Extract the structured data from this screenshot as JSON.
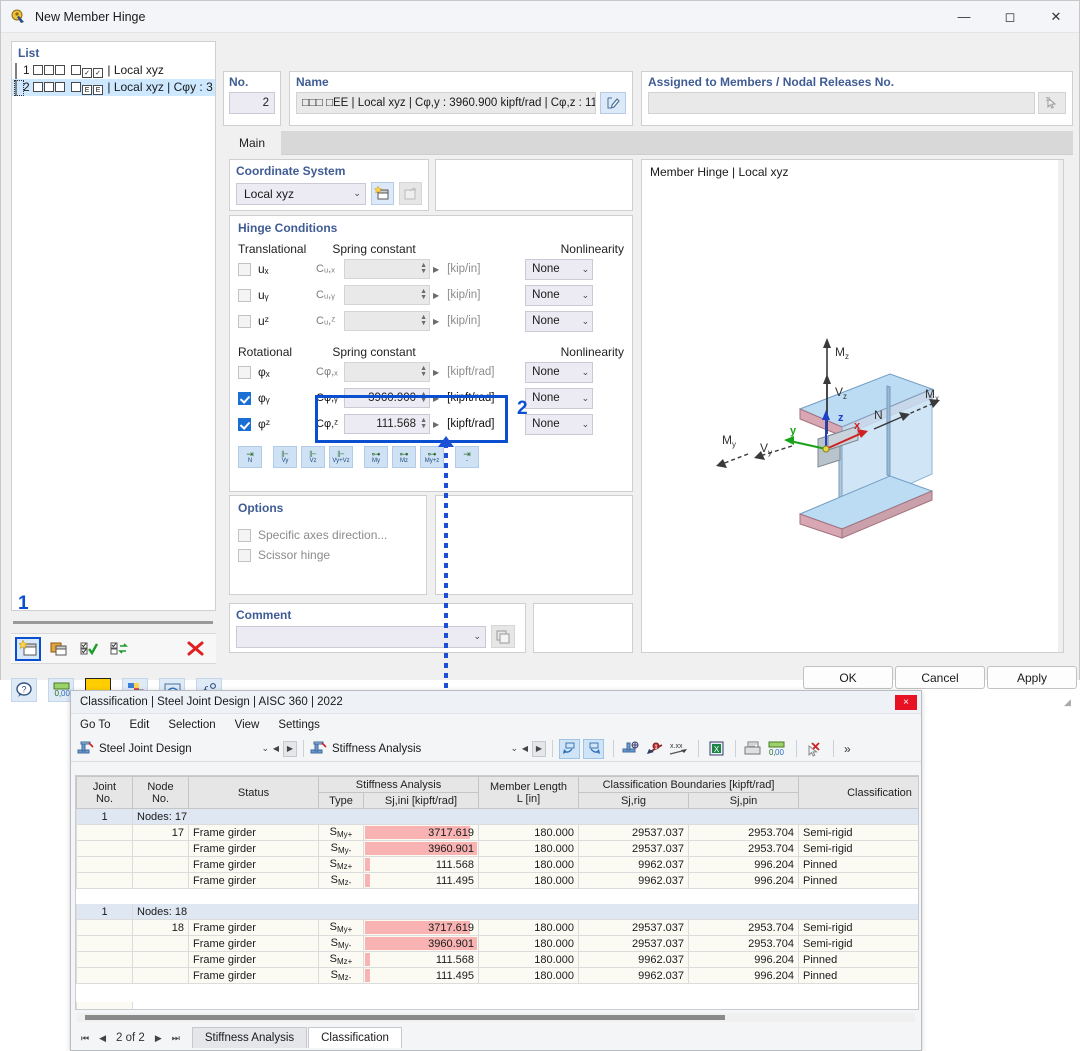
{
  "dialog": {
    "title": "New Member Hinge",
    "window_buttons": {
      "minimize": "—",
      "maximize": "◻",
      "close": "✕"
    },
    "list": {
      "label": "List",
      "items": [
        {
          "num": "1",
          "glyphs": [
            "",
            "",
            "",
            "",
            "✓",
            "✓"
          ],
          "text": "| Local xyz",
          "color": "#bff0ef",
          "selected": false
        },
        {
          "num": "2",
          "glyphs": [
            "",
            "",
            "",
            "",
            "E",
            "E"
          ],
          "text": "| Local xyz | Cφy : 3",
          "color": "#a0a32a",
          "selected": true
        }
      ],
      "marker": "1"
    },
    "no": {
      "label": "No.",
      "value": "2"
    },
    "name": {
      "label": "Name",
      "value": "□□□  □EE | Local xyz | Cφ,y : 3960.900 kipft/rad | Cφ,z : 11"
    },
    "assigned": {
      "label": "Assigned to Members / Nodal Releases No.",
      "value": ""
    },
    "tabs": [
      {
        "label": "Main",
        "active": true
      }
    ],
    "coordinate_system": {
      "label": "Coordinate System",
      "value": "Local xyz"
    },
    "hinge_conditions": {
      "label": "Hinge Conditions",
      "translational_header": "Translational",
      "rotational_header": "Rotational",
      "spring_header": "Spring constant",
      "nonlinearity_header": "Nonlinearity",
      "translational_rows": [
        {
          "dof": "uₓ",
          "const": "Cᵤ,ₓ",
          "value": "",
          "unit": "[kip/in]",
          "nonlinearity": "None",
          "checked": false
        },
        {
          "dof": "uᵧ",
          "const": "Cᵤ,ᵧ",
          "value": "",
          "unit": "[kip/in]",
          "nonlinearity": "None",
          "checked": false
        },
        {
          "dof": "uᶻ",
          "const": "Cᵤ,ᶻ",
          "value": "",
          "unit": "[kip/in]",
          "nonlinearity": "None",
          "checked": false
        }
      ],
      "rotational_rows": [
        {
          "dof": "φₓ",
          "const": "Cφ,ₓ",
          "value": "",
          "unit": "[kipft/rad]",
          "nonlinearity": "None",
          "checked": false
        },
        {
          "dof": "φᵧ",
          "const": "Cφ,ᵧ",
          "value": "3960.900",
          "unit": "[kipft/rad]",
          "nonlinearity": "None",
          "checked": true
        },
        {
          "dof": "φᶻ",
          "const": "Cφ,ᶻ",
          "value": "111.568",
          "unit": "[kipft/rad]",
          "nonlinearity": "None",
          "checked": true
        }
      ],
      "marker": "2",
      "preset_buttons": [
        "N",
        "Vy",
        "Vz",
        "Vy+Vz",
        "My",
        "Mz",
        "My+z",
        "-"
      ]
    },
    "options": {
      "label": "Options",
      "items": [
        {
          "label": "Specific axes direction...",
          "checked": false
        },
        {
          "label": "Scissor hinge",
          "checked": false
        }
      ]
    },
    "comment": {
      "label": "Comment",
      "value": ""
    },
    "preview": {
      "title": "Member Hinge | Local xyz",
      "labels": {
        "mz": "M",
        "mz_sub": "z",
        "vz": "V",
        "vz_sub": "z",
        "mx": "M",
        "mx_sub": "x",
        "n": "N",
        "my": "M",
        "my_sub": "y",
        "vy": "V",
        "vy_sub": "y",
        "axis_x": "x",
        "axis_y": "y",
        "axis_z": "z"
      }
    },
    "footer": {
      "ok": "OK",
      "cancel": "Cancel",
      "apply": "Apply"
    }
  },
  "classification": {
    "title": "Classification | Steel Joint Design | AISC 360 | 2022",
    "close": "×",
    "menu": [
      "Go To",
      "Edit",
      "Selection",
      "View",
      "Settings"
    ],
    "toolbar": {
      "left_combo": "Steel Joint Design",
      "right_combo": "Stiffness Analysis",
      "overflow": "»"
    },
    "table": {
      "headers": {
        "joint_no": "Joint",
        "joint_no2": "No.",
        "node_no": "Node",
        "node_no2": "No.",
        "status": "Status",
        "stiffness_analysis": "Stiffness Analysis",
        "type": "Type",
        "sj_ini": "Sj,ini [kipft/rad]",
        "member_length": "Member Length",
        "member_length2": "L [in]",
        "classification_boundaries": "Classification Boundaries [kipft/rad]",
        "sj_rig": "Sj,rig",
        "sj_pin": "Sj,pin",
        "classification": "Classification"
      },
      "groups": [
        {
          "joint_no": "1",
          "group_label": "Nodes: 17",
          "rows": [
            {
              "node_no": "17",
              "status": "Frame girder",
              "type": "S",
              "type_sub": "My+",
              "sj_ini": "3717.619",
              "bar": 0.92,
              "length": "180.000",
              "sj_rig": "29537.037",
              "sj_pin": "2953.704",
              "classification": "Semi-rigid"
            },
            {
              "node_no": "",
              "status": "Frame girder",
              "type": "S",
              "type_sub": "My-",
              "sj_ini": "3960.901",
              "bar": 0.98,
              "length": "180.000",
              "sj_rig": "29537.037",
              "sj_pin": "2953.704",
              "classification": "Semi-rigid"
            },
            {
              "node_no": "",
              "status": "Frame girder",
              "type": "S",
              "type_sub": "Mz+",
              "sj_ini": "111.568",
              "bar": 0.05,
              "length": "180.000",
              "sj_rig": "9962.037",
              "sj_pin": "996.204",
              "classification": "Pinned"
            },
            {
              "node_no": "",
              "status": "Frame girder",
              "type": "S",
              "type_sub": "Mz-",
              "sj_ini": "111.495",
              "bar": 0.05,
              "length": "180.000",
              "sj_rig": "9962.037",
              "sj_pin": "996.204",
              "classification": "Pinned"
            }
          ]
        },
        {
          "joint_no": "1",
          "group_label": "Nodes: 18",
          "rows": [
            {
              "node_no": "18",
              "status": "Frame girder",
              "type": "S",
              "type_sub": "My+",
              "sj_ini": "3717.619",
              "bar": 0.92,
              "length": "180.000",
              "sj_rig": "29537.037",
              "sj_pin": "2953.704",
              "classification": "Semi-rigid"
            },
            {
              "node_no": "",
              "status": "Frame girder",
              "type": "S",
              "type_sub": "My-",
              "sj_ini": "3960.901",
              "bar": 0.98,
              "length": "180.000",
              "sj_rig": "29537.037",
              "sj_pin": "2953.704",
              "classification": "Semi-rigid"
            },
            {
              "node_no": "",
              "status": "Frame girder",
              "type": "S",
              "type_sub": "Mz+",
              "sj_ini": "111.568",
              "bar": 0.05,
              "length": "180.000",
              "sj_rig": "9962.037",
              "sj_pin": "996.204",
              "classification": "Pinned"
            },
            {
              "node_no": "",
              "status": "Frame girder",
              "type": "S",
              "type_sub": "Mz-",
              "sj_ini": "111.495",
              "bar": 0.05,
              "length": "180.000",
              "sj_rig": "9962.037",
              "sj_pin": "996.204",
              "classification": "Pinned"
            }
          ]
        }
      ]
    },
    "pager": {
      "first": "⏮",
      "prev": "◀",
      "text": "2 of 2",
      "next": "▶",
      "last": "⏭"
    },
    "sheet_tabs": [
      {
        "label": "Stiffness Analysis",
        "active": false
      },
      {
        "label": "Classification",
        "active": true
      }
    ]
  },
  "colors": {
    "accent_blue": "#0b4fd1",
    "highlight_row": "#cde8ff",
    "bar_pink": "#f9b3b3",
    "group_row": "#dfe7f2",
    "label_blue": "#3f5c94"
  }
}
